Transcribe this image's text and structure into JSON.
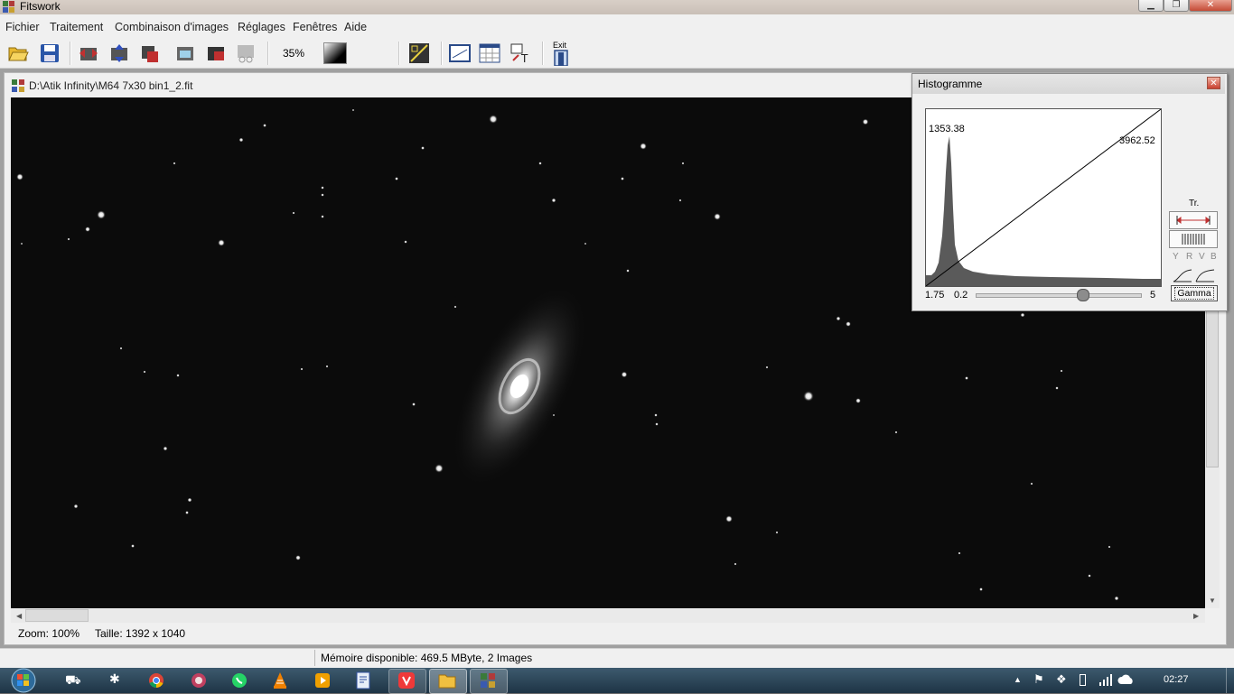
{
  "window": {
    "title": "Fitswork"
  },
  "menu": [
    "Fichier",
    "Traitement",
    "Combinaison d'images",
    "Réglages",
    "Fenêtres",
    "Aide"
  ],
  "toolbar": {
    "zoom_label": "35%",
    "exit_label": "Exit"
  },
  "image_window": {
    "title": "D:\\Atik Infinity\\M64 7x30 bin1_2.fit",
    "zoom_status": "Zoom: 100%",
    "size_status": "Taille: 1392 x 1040"
  },
  "histogram": {
    "title": "Histogramme",
    "peak_label": "1353.38",
    "max_label": "3962.52",
    "tr_label": "Tr.",
    "channels": [
      "Y",
      "R",
      "V",
      "B"
    ],
    "gamma_value": "1.75",
    "slider_min": "0.2",
    "slider_max": "5",
    "slider_level": 0.65,
    "gamma_button": "Gamma"
  },
  "status_bar": {
    "memory": "Mémoire disponible: 469.5 MByte, 2 Images"
  },
  "taskbar": {
    "clock": "02:27"
  },
  "colors": {
    "accent": "#1e3445",
    "image_bg": "#0b0b0b",
    "histogram_fill": "#5a5a5a"
  }
}
